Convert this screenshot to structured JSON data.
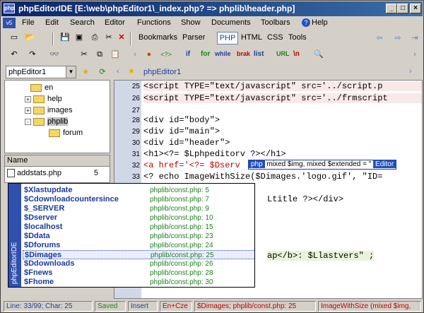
{
  "window": {
    "title": "phpEditorIDE  [E:\\web\\phpEditor1\\_index.php? => phplib\\header.php]",
    "app_icon": "php",
    "minimize": "_",
    "maximize": "□",
    "close": "×"
  },
  "menu": {
    "items": [
      "File",
      "Edit",
      "Search",
      "Editor",
      "Functions",
      "Show",
      "Documents",
      "Toolbars",
      "Help"
    ],
    "sys_icon": "v5"
  },
  "toolbar": {
    "bookmarks": "Bookmarks",
    "parser": "Parser",
    "tabs": [
      "PHP",
      "HTML",
      "CSS",
      "Tools"
    ],
    "tokens": [
      "if",
      "for",
      "while",
      "brak",
      "list",
      "URL",
      "\\n"
    ]
  },
  "left_panel": {
    "project_select": "phpEditor1",
    "tree": [
      {
        "label": "en",
        "indent": 2,
        "expander": ""
      },
      {
        "label": "help",
        "indent": 1,
        "expander": "+"
      },
      {
        "label": "images",
        "indent": 1,
        "expander": "+"
      },
      {
        "label": "phplib",
        "indent": 1,
        "expander": "-",
        "selected": true
      },
      {
        "label": "forum",
        "indent": 3,
        "expander": ""
      }
    ],
    "list_header": "Name",
    "list_item": "addstats.php",
    "list_item_count": "5"
  },
  "editor": {
    "tab_label": "phpEditor1",
    "lines": [
      {
        "n": "25",
        "text": "<script TYPE=\"text/javascript\" src='../script.p"
      },
      {
        "n": "26",
        "text": "<script TYPE=\"text/javascript\" src='../frmscript"
      },
      {
        "n": "27",
        "text": ""
      },
      {
        "n": "28",
        "text": "<div id=\"body\">"
      },
      {
        "n": "29",
        "text": "<div id=\"main\">"
      },
      {
        "n": "30",
        "text": "<div id=\"header\">"
      },
      {
        "n": "31",
        "text": "<h1><?= $Lphpeditorv ?></h1>"
      },
      {
        "n": "32",
        "text": "<a href='<?= $Dserv"
      },
      {
        "n": "33",
        "text": "<? echo ImageWithSize($Dimages.'logo.gif', \"ID="
      }
    ],
    "hidden_fragments": [
      "Ltitle ?></div>",
      "ap</b>: $Llastvers\" ;"
    ]
  },
  "hint": {
    "tag": "php",
    "text": "mixed $img, mixed $extended = \"",
    "editor_tag": "Editor"
  },
  "autocomplete": {
    "side_label": "phpEditorIDE",
    "items": [
      {
        "name": "$Xlastupdate",
        "file": "phplib/const.php: 5"
      },
      {
        "name": "$Cdownloadcountersince",
        "file": "phplib/const.php: 7"
      },
      {
        "name": "$_SERVER",
        "file": "phplib/const.php: 9"
      },
      {
        "name": "$Dserver",
        "file": "phplib/const.php: 10"
      },
      {
        "name": "$localhost",
        "file": "phplib/const.php: 15"
      },
      {
        "name": "$Ddata",
        "file": "phplib/const.php: 23"
      },
      {
        "name": "$Dforums",
        "file": "phplib/const.php: 24"
      },
      {
        "name": "$Dimages",
        "file": "phplib/const.php: 25",
        "active": true
      },
      {
        "name": "$Ddownloads",
        "file": "phplib/const.php: 26"
      },
      {
        "name": "$Fnews",
        "file": "phplib/const.php: 28"
      },
      {
        "name": "$Fhome",
        "file": "phplib/const.php: 30"
      }
    ]
  },
  "status": {
    "position": "Line: 33/99; Char: 25",
    "saved": "Saved",
    "mode": "Insert",
    "encoding": "En+Cze",
    "symbol": "$Dimages; phplib/const.php: 25",
    "function": "ImageWithSize (mixed $img,"
  },
  "colors": {
    "title_start": "#0a246a",
    "title_end": "#3a6ea5",
    "status_red": "#c00000"
  }
}
